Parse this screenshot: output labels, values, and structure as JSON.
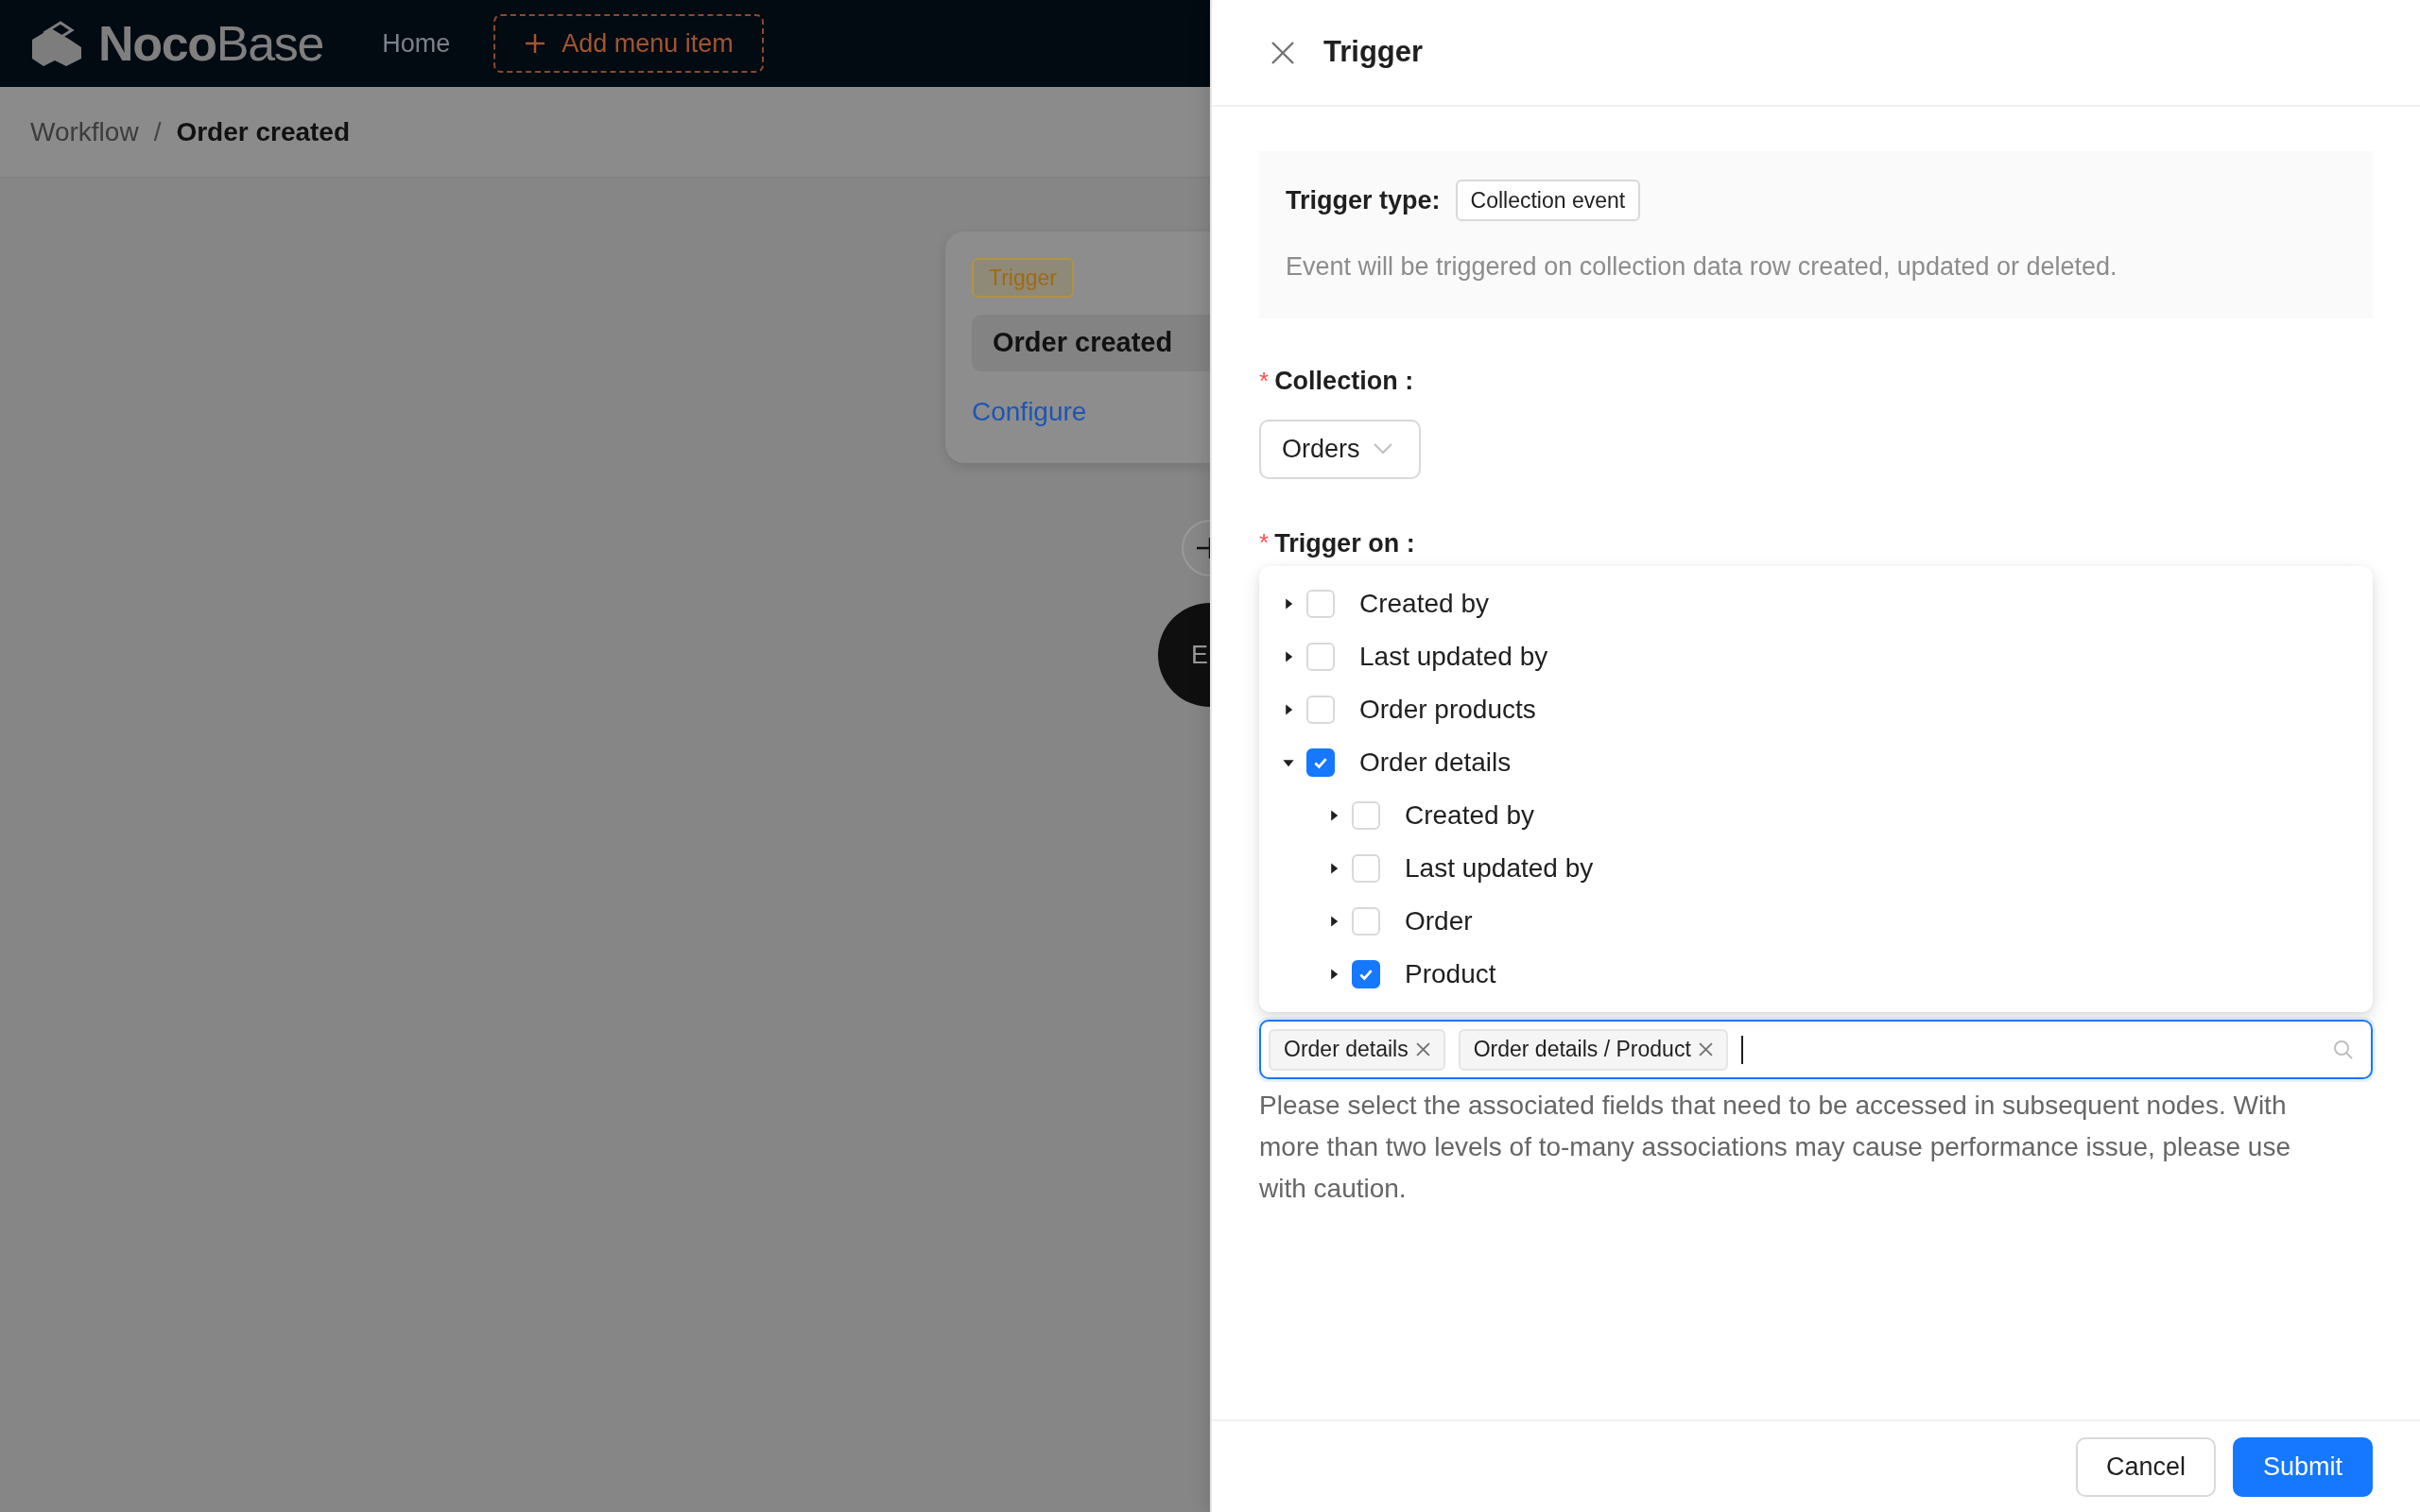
{
  "top_bar": {
    "logo": {
      "bold": "Noco",
      "light": "Base"
    },
    "menu": [
      "Home"
    ],
    "add_menu_item": "Add menu item"
  },
  "breadcrumb": {
    "separator": "/",
    "items": [
      {
        "label": "Workflow",
        "selected": false
      },
      {
        "label": "Order created",
        "selected": true
      }
    ]
  },
  "canvas": {
    "trigger_node": {
      "tag": "Trigger",
      "title": "Order created",
      "link": "Configure"
    },
    "end_node": {
      "label": "E"
    }
  },
  "drawer": {
    "title": "Trigger",
    "trigger_type": {
      "label": "Trigger type:",
      "value": "Collection event",
      "description": "Event will be triggered on collection data row created, updated or deleted."
    },
    "collection": {
      "required_mark": "*",
      "label": "Collection :",
      "value": "Orders"
    },
    "trigger_on": {
      "required_mark": "*",
      "label": "Trigger on :",
      "tree": [
        {
          "label": "Created by",
          "checked": false,
          "expanded": false
        },
        {
          "label": "Last updated by",
          "checked": false,
          "expanded": false
        },
        {
          "label": "Order products",
          "checked": false,
          "expanded": false
        },
        {
          "label": "Order details",
          "checked": true,
          "expanded": true,
          "children": [
            {
              "label": "Created by",
              "checked": false,
              "expanded": false
            },
            {
              "label": "Last updated by",
              "checked": false,
              "expanded": false
            },
            {
              "label": "Order",
              "checked": false,
              "expanded": false
            },
            {
              "label": "Product",
              "checked": true,
              "expanded": false
            }
          ]
        }
      ],
      "tags": [
        "Order details",
        "Order details / Product"
      ],
      "help": "Please select the associated fields that need to be accessed in subsequent nodes. With more than two levels of to-many associations may cause performance issue, please use with caution."
    },
    "buttons": [
      {
        "label": "Cancel",
        "kind": "default"
      },
      {
        "label": "Submit",
        "kind": "primary"
      }
    ]
  }
}
